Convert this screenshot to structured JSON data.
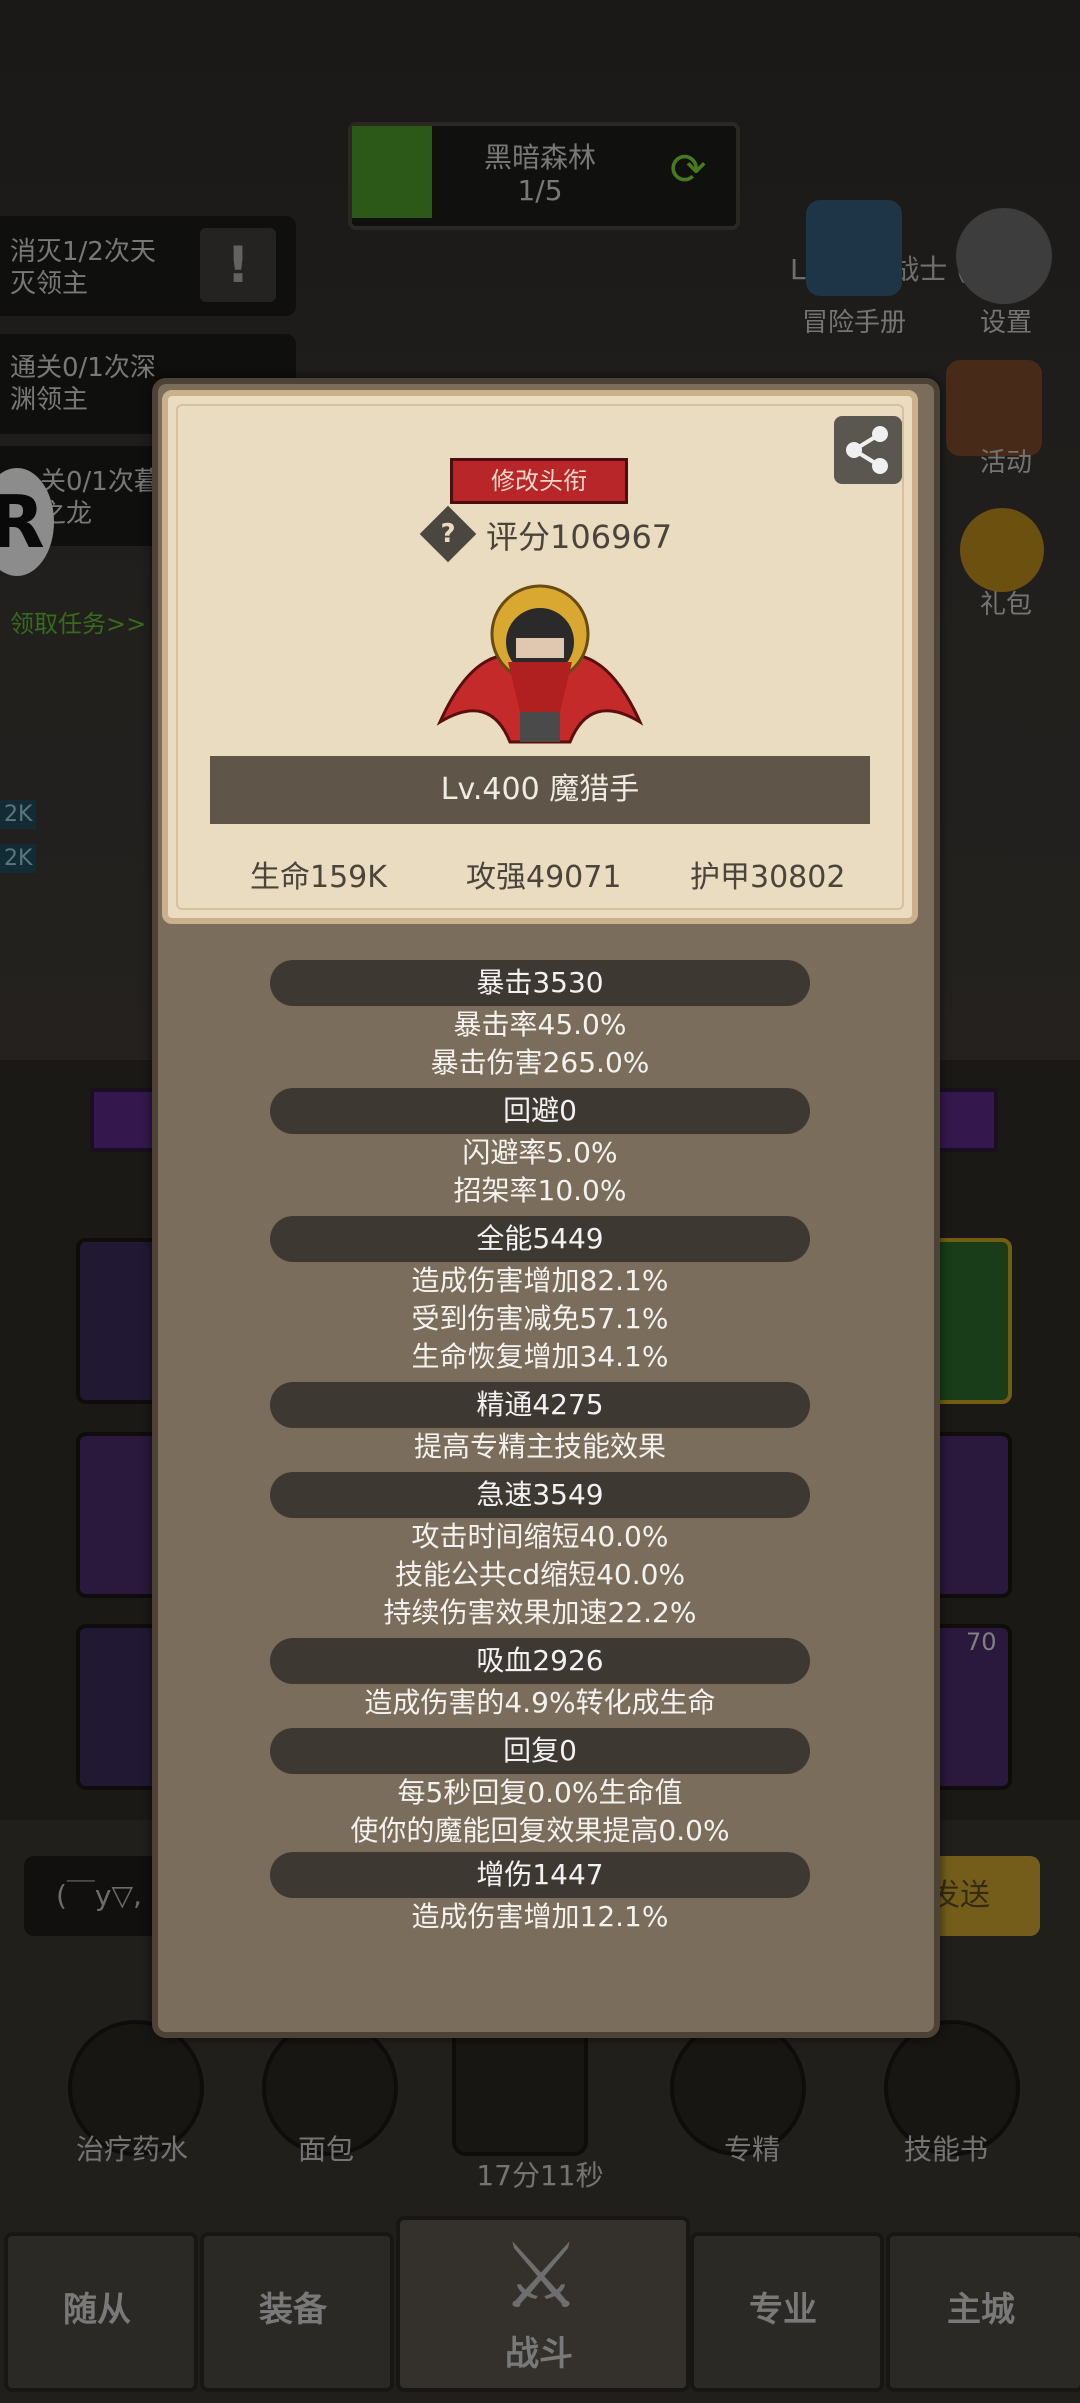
{
  "stage": {
    "name": "黑暗森林",
    "progress": "1/5"
  },
  "tasks": [
    {
      "text": "消灭1/2次天\n灭领主"
    },
    {
      "text": "通关0/1次深\n渊领主"
    },
    {
      "text": "关0/1次暮\n之龙"
    }
  ],
  "task_link": "领取任务>>",
  "top_right": {
    "level_text": "Lv.400 战士 (￣y▽,",
    "adventure_label": "冒险手册",
    "settings_label": "设置",
    "activity_label": "活动",
    "gift_label": "礼包"
  },
  "side_badges": [
    "2K",
    "2K"
  ],
  "slot_badge": "70",
  "chat_input": "(￣y▽,",
  "send_label": "发送",
  "bottom_items": [
    {
      "label": "治疗药水"
    },
    {
      "label": "面包"
    },
    {
      "label": "17分11秒"
    },
    {
      "label": "专精"
    },
    {
      "label": "技能书"
    }
  ],
  "nav": [
    {
      "label": "随从"
    },
    {
      "label": "装备"
    },
    {
      "label": "战斗"
    },
    {
      "label": "专业"
    },
    {
      "label": "主城"
    }
  ],
  "dialog": {
    "title_button": "修改头衔",
    "score": "评分106967",
    "name": "Lv.400 魔猎手",
    "hp": "生命159K",
    "attack": "攻强49071",
    "armor": "护甲30802",
    "stats": [
      {
        "header": "暴击3530",
        "lines": [
          "暴击率45.0%",
          "暴击伤害265.0%"
        ]
      },
      {
        "header": "回避0",
        "lines": [
          "闪避率5.0%",
          "招架率10.0%"
        ]
      },
      {
        "header": "全能5449",
        "lines": [
          "造成伤害增加82.1%",
          "受到伤害减免57.1%",
          "生命恢复增加34.1%"
        ]
      },
      {
        "header": "精通4275",
        "lines": [
          "提高专精主技能效果"
        ]
      },
      {
        "header": "急速3549",
        "lines": [
          "攻击时间缩短40.0%",
          "技能公共cd缩短40.0%",
          "持续伤害效果加速22.2%"
        ]
      },
      {
        "header": "吸血2926",
        "lines": [
          "造成伤害的4.9%转化成生命"
        ]
      },
      {
        "header": "回复0",
        "lines": [
          "每5秒回复0.0%生命值",
          "使你的魔能回复效果提高0.0%"
        ]
      },
      {
        "header": "增伤1447",
        "lines": [
          "造成伤害增加12.1%"
        ]
      }
    ]
  },
  "colors": {
    "accent_red": "#b8262a",
    "panel": "#7b6d5c",
    "card": "#e9dcc0",
    "stat_bar": "#3e3832",
    "task_link": "#5cb82e"
  }
}
